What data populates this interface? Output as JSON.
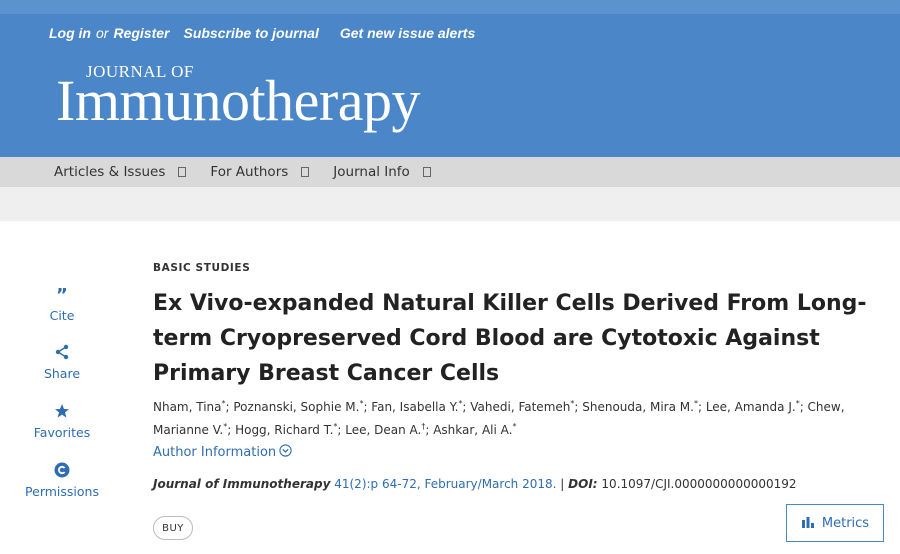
{
  "header": {
    "login": "Log in",
    "or": "or",
    "register": "Register",
    "subscribe": "Subscribe to journal",
    "alerts": "Get new issue alerts",
    "logo_small": "JOURNAL OF",
    "logo_big": "Immunotherapy"
  },
  "nav": {
    "items": [
      {
        "label": "Articles & Issues"
      },
      {
        "label": "For Authors"
      },
      {
        "label": "Journal Info"
      }
    ]
  },
  "sidebar": {
    "items": [
      {
        "label": "Cite",
        "icon": "quote-icon"
      },
      {
        "label": "Share",
        "icon": "share-icon"
      },
      {
        "label": "Favorites",
        "icon": "star-icon"
      },
      {
        "label": "Permissions",
        "icon": "copyright-icon"
      }
    ]
  },
  "article": {
    "section": "BASIC STUDIES",
    "title": "Ex Vivo-expanded Natural Killer Cells Derived From Long-term Cryopreserved Cord Blood are Cytotoxic Against Primary Breast Cancer Cells",
    "authors": [
      {
        "name": "Nham, Tina",
        "mark": "*"
      },
      {
        "name": "Poznanski, Sophie M.",
        "mark": "*"
      },
      {
        "name": "Fan, Isabella Y.",
        "mark": "*"
      },
      {
        "name": "Vahedi, Fatemeh",
        "mark": "*"
      },
      {
        "name": "Shenouda, Mira M.",
        "mark": "*"
      },
      {
        "name": "Lee, Amanda J.",
        "mark": "*"
      },
      {
        "name": "Chew, Marianne V.",
        "mark": "*"
      },
      {
        "name": "Hogg, Richard T.",
        "mark": "*"
      },
      {
        "name": "Lee, Dean A.",
        "mark": "†"
      },
      {
        "name": "Ashkar, Ali A.",
        "mark": "*"
      }
    ],
    "author_info": "Author Information",
    "journal": "Journal of Immunotherapy",
    "volume": "41(2):p 64-72, February/March 2018.",
    "separator": "|",
    "doi_label": "DOI:",
    "doi": "10.1097/CJI.0000000000000192",
    "buy": "BUY",
    "metrics": "Metrics"
  },
  "colors": {
    "header": "#4a86c8",
    "link": "#2f6db0",
    "nav_bg": "#d9d9d9"
  }
}
